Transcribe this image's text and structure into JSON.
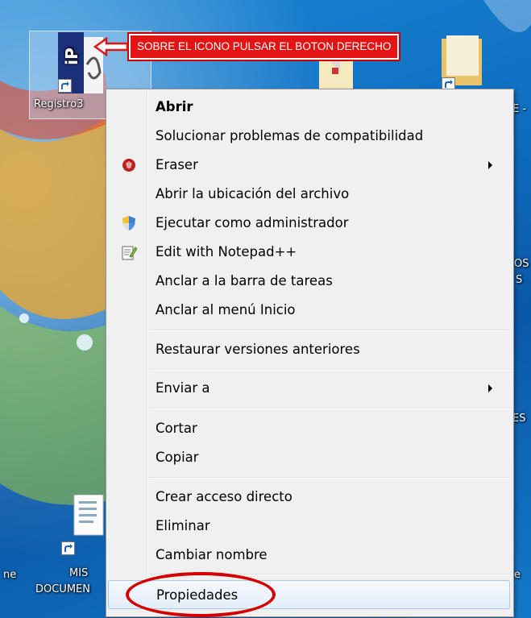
{
  "annotation": {
    "text": "SOBRE EL ICONO PULSAR EL BOTON DERECHO"
  },
  "desktop_icons": {
    "selected_label": "Registro3",
    "right_label_1": "E -",
    "right_label_2": "OS",
    "right_label_3": "S",
    "right_label_4": "ES",
    "left_label_bottom": "ne",
    "mis_documentos_line1": "MIS",
    "mis_documentos_line2": "DOCUMEN",
    "right_label_bottom": "e"
  },
  "context_menu": {
    "items": [
      {
        "label": "Abrir",
        "bold": true,
        "icon": ""
      },
      {
        "label": "Solucionar problemas de compatibilidad",
        "icon": ""
      },
      {
        "label": "Eraser",
        "icon": "eraser-icon",
        "submenu": true
      },
      {
        "label": "Abrir la ubicación del archivo",
        "icon": ""
      },
      {
        "label": "Ejecutar como administrador",
        "icon": "uac-shield-icon"
      },
      {
        "label": "Edit with Notepad++",
        "icon": "notepad-icon"
      },
      {
        "label": "Anclar a la barra de tareas",
        "icon": ""
      },
      {
        "label": "Anclar al menú Inicio",
        "icon": ""
      },
      {
        "label": "Restaurar versiones anteriores",
        "icon": ""
      },
      {
        "label": "Enviar a",
        "icon": "",
        "submenu": true
      },
      {
        "label": "Cortar",
        "icon": ""
      },
      {
        "label": "Copiar",
        "icon": ""
      },
      {
        "label": "Crear acceso directo",
        "icon": ""
      },
      {
        "label": "Eliminar",
        "icon": ""
      },
      {
        "label": "Cambiar nombre",
        "icon": ""
      },
      {
        "label": "Propiedades",
        "icon": "",
        "highlighted": true
      }
    ]
  },
  "colors": {
    "annotation_red": "#e21414",
    "circle_red": "#d40000",
    "menu_bg": "#f0f0f0"
  }
}
